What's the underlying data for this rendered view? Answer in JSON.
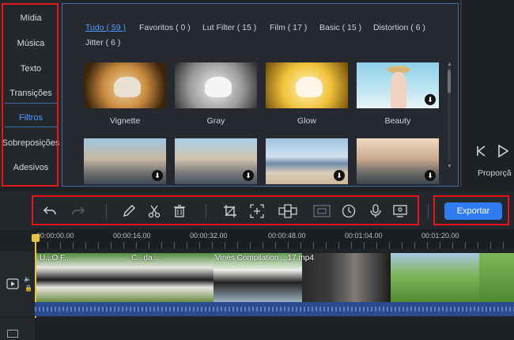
{
  "sidebar": {
    "items": [
      {
        "label": "Mídia"
      },
      {
        "label": "Música"
      },
      {
        "label": "Texto"
      },
      {
        "label": "Transições"
      },
      {
        "label": "Filtros"
      },
      {
        "label": "Sobreposições"
      },
      {
        "label": "Adesivos"
      }
    ],
    "active_index": 4
  },
  "filters": {
    "tabs": [
      {
        "label": "Tudo ( 59 )"
      },
      {
        "label": "Favoritos ( 0 )"
      },
      {
        "label": "Lut Filter ( 15 )"
      },
      {
        "label": "Film ( 17 )"
      },
      {
        "label": "Basic ( 15 )"
      },
      {
        "label": "Distortion ( 6 )"
      },
      {
        "label": "Jitter ( 6 )"
      }
    ],
    "items": [
      {
        "label": "Vignette",
        "download": false
      },
      {
        "label": "Gray",
        "download": false
      },
      {
        "label": "Glow",
        "download": false
      },
      {
        "label": "Beauty",
        "download": true
      },
      {
        "label": "",
        "download": true
      },
      {
        "label": "",
        "download": true
      },
      {
        "label": "",
        "download": true
      },
      {
        "label": "",
        "download": true
      }
    ]
  },
  "preview": {
    "label": "Proporçã"
  },
  "toolbar": {
    "icons": [
      "undo-icon",
      "redo-icon",
      "edit-icon",
      "cut-icon",
      "delete-icon",
      "crop-icon",
      "zoom-icon",
      "mosaic-icon",
      "freeze-icon",
      "duration-icon",
      "voiceover-icon",
      "record-screen-icon"
    ],
    "export_label": "Exportar"
  },
  "timeline": {
    "ticks": [
      "00:00:00.00",
      "00:00:16.00",
      "00:00:32.00",
      "00:00:48.00",
      "00:01:04.00",
      "00:01:20.00"
    ],
    "clips": [
      {
        "title": "U...O F..."
      },
      {
        "title": "C...da..."
      },
      {
        "title": "Vines Compilation ...17.mp4"
      }
    ]
  },
  "colors": {
    "accent": "#2f7bf0",
    "highlight": "#e8171c",
    "active_text": "#4c9dff"
  }
}
